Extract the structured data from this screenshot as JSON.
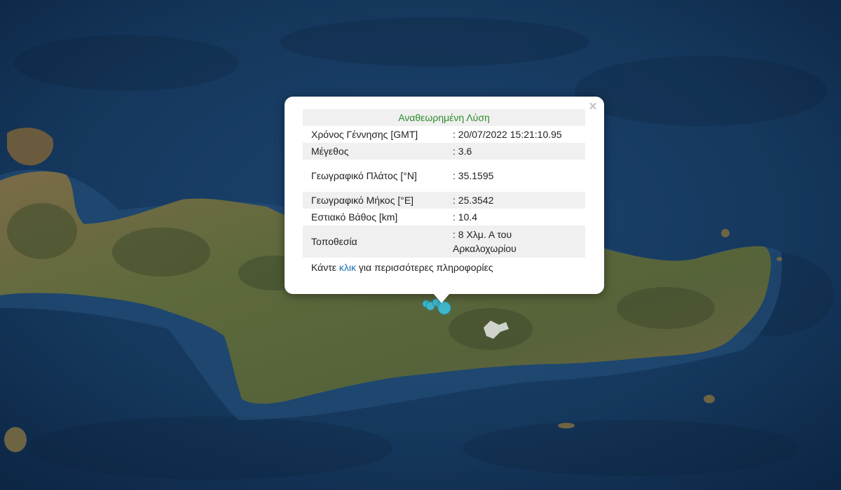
{
  "map": {
    "colors": {
      "sea_deep": "#0c2745",
      "sea": "#163a60",
      "sea_shallow": "#2a5275",
      "land_green": "#55643a",
      "land_brown": "#7a6a4a",
      "land_dark": "#3f4a2c",
      "snow": "#e8e8e8",
      "quake_marker": "#3fb6c8",
      "quake_marker_stroke": "#2a8ea0"
    }
  },
  "popup": {
    "title": "Αναθεωρημένη Λύση",
    "rows": [
      {
        "label": "Χρόνος Γέννησης [GMT]",
        "value": ": 20/07/2022 15:21:10.95"
      },
      {
        "label": "Μέγεθος",
        "value": ": 3.6"
      },
      {
        "label": "Γεωγραφικό Πλάτος [°N]",
        "value": ": 35.1595"
      },
      {
        "label": "Γεωγραφικό Μήκος [°E]",
        "value": ": 25.3542"
      },
      {
        "label": "Εστιακό Βάθος [km]",
        "value": ": 10.4"
      },
      {
        "label": "Τοποθεσία",
        "value": ": 8 Χλμ. Α του Αρκαλοχωρίου"
      }
    ],
    "more_before": "Κάντε ",
    "more_link": "κλικ",
    "more_after": " για περισσότερες πληροφορίες",
    "close_symbol": "×"
  }
}
